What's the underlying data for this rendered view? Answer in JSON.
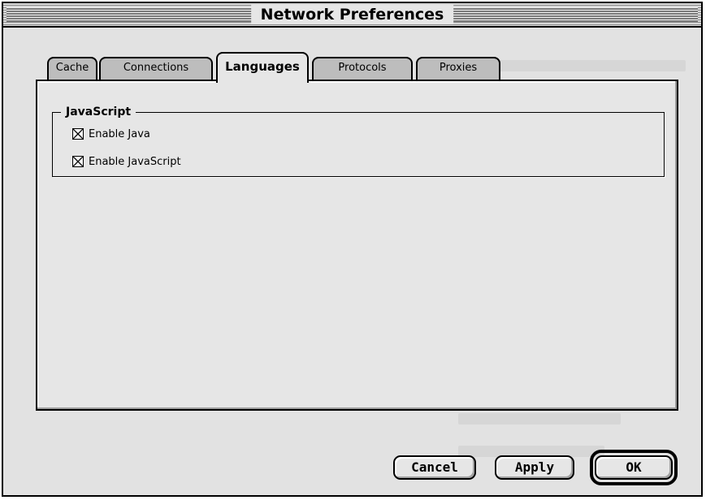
{
  "window": {
    "title": "Network Preferences"
  },
  "tabs": [
    {
      "label": "Cache",
      "active": false
    },
    {
      "label": "Connections",
      "active": false
    },
    {
      "label": "Languages",
      "active": true
    },
    {
      "label": "Protocols",
      "active": false
    },
    {
      "label": "Proxies",
      "active": false
    }
  ],
  "group": {
    "title": "JavaScript",
    "options": [
      {
        "label": "Enable Java",
        "checked": true
      },
      {
        "label": "Enable JavaScript",
        "checked": true
      }
    ]
  },
  "buttons": {
    "cancel_label": "Cancel",
    "apply_label": "Apply",
    "ok_label": "OK",
    "default": "OK"
  },
  "icons": {
    "checkbox_mark": "x-mark-icon"
  }
}
